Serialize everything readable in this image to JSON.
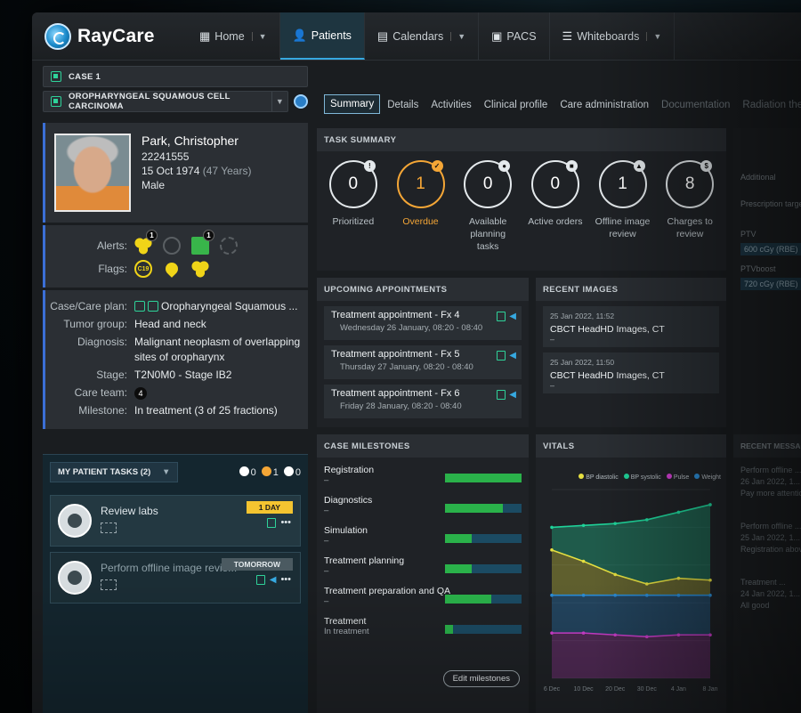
{
  "app": {
    "name": "RayCare"
  },
  "nav": [
    {
      "label": "Home",
      "icon": "grid-icon",
      "caret": true,
      "active": false
    },
    {
      "label": "Patients",
      "icon": "person-icon",
      "caret": false,
      "active": true
    },
    {
      "label": "Calendars",
      "icon": "calendar-icon",
      "caret": true,
      "active": false
    },
    {
      "label": "PACS",
      "icon": "pacs-icon",
      "caret": false,
      "active": false
    },
    {
      "label": "Whiteboards",
      "icon": "list-icon",
      "caret": true,
      "active": false
    }
  ],
  "case_selector": {
    "case": "CASE 1",
    "diagnosis": "OROPHARYNGEAL SQUAMOUS CELL CARCINOMA"
  },
  "patient": {
    "name": "Park, Christopher",
    "id": "22241555",
    "dob": "15 Oct 1974",
    "age": "(47 Years)",
    "sex": "Male"
  },
  "alerts": {
    "label": "Alerts:",
    "count_1": "1",
    "count_2": "1"
  },
  "flags": {
    "label": "Flags:",
    "covid": "C19"
  },
  "case_info": {
    "case_plan_label": "Case/Care plan:",
    "case_plan": "Oropharyngeal Squamous ...",
    "tumor_group_label": "Tumor group:",
    "tumor_group": "Head and neck",
    "diagnosis_label": "Diagnosis:",
    "diagnosis": "Malignant neoplasm of overlapping sites of oropharynx",
    "stage_label": "Stage:",
    "stage": "T2N0M0 - Stage IB2",
    "care_team_label": "Care team:",
    "care_team": "4",
    "milestone_label": "Milestone:",
    "milestone": "In treatment (3 of 25 fractions)"
  },
  "my_tasks": {
    "title": "MY PATIENT TASKS (2)",
    "counts": [
      "0",
      "1",
      "0"
    ],
    "items": [
      {
        "title": "Review labs",
        "due": "1 DAY"
      },
      {
        "title": "Perform offline image revie...",
        "due": "TOMORROW"
      }
    ]
  },
  "tabs": [
    "Summary",
    "Details",
    "Activities",
    "Clinical profile",
    "Care administration",
    "Documentation",
    "Radiation therapy"
  ],
  "task_summary": {
    "title": "TASK SUMMARY",
    "items": [
      {
        "value": "0",
        "label": "Prioritized",
        "badge": "!"
      },
      {
        "value": "1",
        "label": "Overdue",
        "badge": "✓"
      },
      {
        "value": "0",
        "label": "Available planning tasks",
        "badge": "●"
      },
      {
        "value": "0",
        "label": "Active orders",
        "badge": "■"
      },
      {
        "value": "1",
        "label": "Offline image review",
        "badge": "▲"
      },
      {
        "value": "8",
        "label": "Charges to review",
        "badge": "$"
      }
    ]
  },
  "appointments": {
    "title": "UPCOMING APPOINTMENTS",
    "items": [
      {
        "title": "Treatment appointment - Fx 4",
        "time": "Wednesday 26 January, 08:20 - 08:40"
      },
      {
        "title": "Treatment appointment - Fx 5",
        "time": "Thursday 27 January, 08:20 - 08:40"
      },
      {
        "title": "Treatment appointment - Fx 6",
        "time": "Friday 28 January, 08:20 - 08:40"
      }
    ]
  },
  "recent_images": {
    "title": "RECENT IMAGES",
    "items": [
      {
        "date": "25 Jan 2022, 11:52",
        "name": "CBCT HeadHD Images, CT",
        "sub": "–"
      },
      {
        "date": "25 Jan 2022, 11:50",
        "name": "CBCT HeadHD Images, CT",
        "sub": "–"
      }
    ]
  },
  "milestones": {
    "title": "CASE MILESTONES",
    "edit_label": "Edit milestones",
    "items": [
      {
        "name": "Registration",
        "sub": "–",
        "progress": 1.0
      },
      {
        "name": "Diagnostics",
        "sub": "–",
        "progress": 0.75
      },
      {
        "name": "Simulation",
        "sub": "–",
        "progress": 0.35
      },
      {
        "name": "Treatment planning",
        "sub": "–",
        "progress": 0.35
      },
      {
        "name": "Treatment preparation and QA",
        "sub": "–",
        "progress": 0.6
      },
      {
        "name": "Treatment",
        "sub": "In treatment",
        "progress": 0.1
      }
    ]
  },
  "vitals": {
    "title": "VITALS",
    "legend": [
      "BP diastolic",
      "BP systolic",
      "Pulse",
      "Weight"
    ],
    "x_labels": [
      "6 Dec",
      "10 Dec",
      "20 Dec",
      "30 Dec",
      "4 Jan",
      "8 Jan"
    ]
  },
  "chart_data": {
    "type": "area",
    "x": [
      "6 Dec",
      "10 Dec",
      "20 Dec",
      "30 Dec",
      "4 Jan",
      "8 Jan"
    ],
    "series": [
      {
        "name": "BP systolic",
        "color": "#1fd49a",
        "values": [
          0.8,
          0.81,
          0.82,
          0.84,
          0.88,
          0.92
        ]
      },
      {
        "name": "BP diastolic",
        "color": "#e6e040",
        "values": [
          0.68,
          0.62,
          0.55,
          0.5,
          0.53,
          0.52
        ]
      },
      {
        "name": "Weight",
        "color": "#2c8dd6",
        "values": [
          0.44,
          0.44,
          0.44,
          0.44,
          0.44,
          0.44
        ]
      },
      {
        "name": "Pulse",
        "color": "#d23fd2",
        "values": [
          0.24,
          0.24,
          0.23,
          0.22,
          0.23,
          0.23
        ]
      }
    ]
  },
  "right_panel": {
    "header_text": "Additional",
    "prescription_label": "Prescription target",
    "ptv_label": "PTV",
    "ptv_value": "600 cGy (RBE)",
    "ptvboost_label": "PTVboost",
    "ptvboost_value": "720 cGy (RBE)",
    "messages_title": "RECENT MESSAGES A...",
    "messages": [
      {
        "title": "Perform offline ...",
        "date": "26 Jan 2022, 1...",
        "body": "Pay more attention"
      },
      {
        "title": "Perform offline ...",
        "date": "25 Jan 2022, 1...",
        "body": "Registration abov..."
      },
      {
        "title": "Treatment ...",
        "date": "24 Jan 2022, 1...",
        "body": "All good"
      }
    ]
  }
}
